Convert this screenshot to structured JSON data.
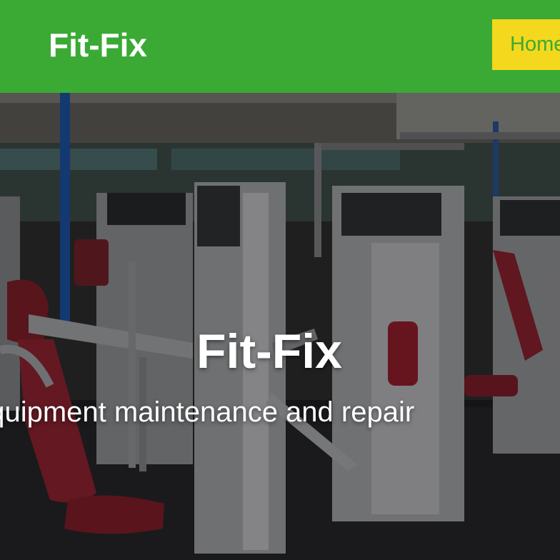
{
  "navbar": {
    "brand": "Fit-Fix",
    "links": [
      {
        "label": "Home",
        "active": true
      }
    ],
    "background_color": "#3aaa35",
    "active_link_color": "#f4d81d"
  },
  "hero": {
    "title": "Fit-Fix",
    "subtitle": "Your exercise equipment maintenance and repair",
    "background_image": "gym-equipment-photo"
  }
}
